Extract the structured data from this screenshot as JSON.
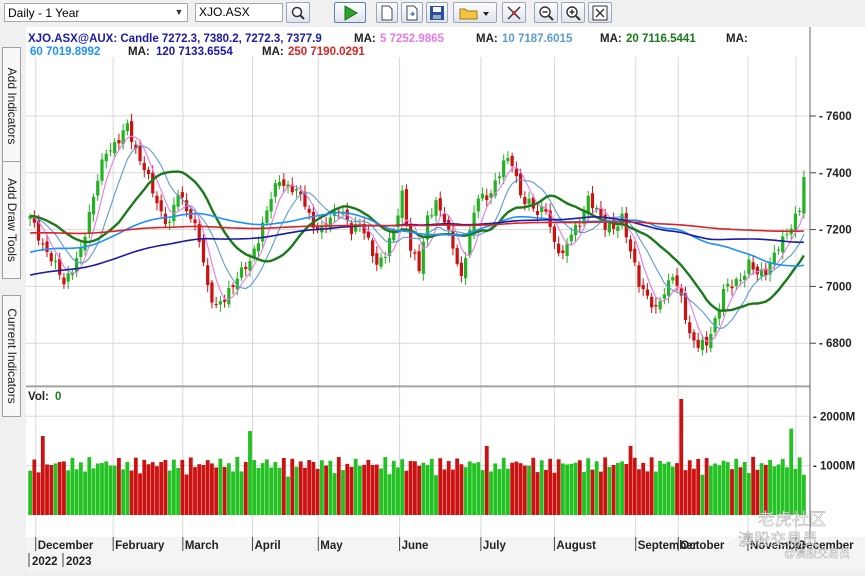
{
  "toolbar": {
    "period": "Daily - 1 Year",
    "symbol": "XJO.ASX",
    "icons": [
      "search-icon",
      "play-icon",
      "new-icon",
      "open-icon",
      "save-icon",
      "folder-icon",
      "crosshair-icon",
      "zoom-out-icon",
      "zoom-in-icon",
      "fit-icon"
    ]
  },
  "sidebar": {
    "tabs": [
      "Add Indicators",
      "Add Draw Tools",
      "Current Indicators"
    ]
  },
  "legend": {
    "symbol": "XJO.ASX@AUX: Candle 7272.3, 7380.2, 7272.3, 7377.9",
    "ma": [
      {
        "label": "MA:",
        "value": "5 7252.9865",
        "color": "#e879e8"
      },
      {
        "label": "MA:",
        "value": "10 7187.6015",
        "color": "#5b9bd5"
      },
      {
        "label": "MA:",
        "value": "20 7116.5441",
        "color": "#1a7a1a"
      },
      {
        "label": "MA:",
        "value": "60 7019.8992",
        "color": "#1e90ff"
      },
      {
        "label": "MA:",
        "value": "120 7133.6554",
        "color": "#1a1aaa"
      },
      {
        "label": "MA:",
        "value": "250 7190.0291",
        "color": "#dd2222"
      }
    ],
    "ma_tail_label": "MA:"
  },
  "volume": {
    "label": "Vol:",
    "value": "0"
  },
  "watermark": {
    "line1": "老虎社区",
    "line2": "澳股交易员",
    "line3": "@澳股交易员"
  },
  "chart_data": {
    "type": "candlestick",
    "price_ylim": [
      6660,
      7790
    ],
    "price_ticks": [
      6800,
      7000,
      7200,
      7400,
      7600
    ],
    "price_tick_labels": [
      "6800",
      "7000",
      "7200",
      "7400",
      "7600"
    ],
    "volume_ylim": [
      0,
      2350
    ],
    "volume_ticks": [
      1000,
      2000
    ],
    "volume_tick_labels": [
      "1000M",
      "2000M"
    ],
    "x_month_labels": [
      "December",
      "February",
      "March",
      "April",
      "May",
      "June",
      "July",
      "August",
      "September",
      "October",
      "November",
      "December"
    ],
    "x_year_labels": [
      "2022",
      "2023"
    ],
    "grid": true,
    "close_anchors": [
      [
        0,
        7240
      ],
      [
        4,
        7120
      ],
      [
        8,
        7020
      ],
      [
        10,
        7060
      ],
      [
        12,
        7120
      ],
      [
        14,
        7260
      ],
      [
        16,
        7380
      ],
      [
        18,
        7470
      ],
      [
        21,
        7520
      ],
      [
        23,
        7560
      ],
      [
        25,
        7480
      ],
      [
        27,
        7420
      ],
      [
        29,
        7330
      ],
      [
        31,
        7260
      ],
      [
        33,
        7220
      ],
      [
        35,
        7330
      ],
      [
        38,
        7250
      ],
      [
        40,
        7160
      ],
      [
        42,
        7000
      ],
      [
        44,
        6930
      ],
      [
        46,
        6950
      ],
      [
        49,
        7040
      ],
      [
        52,
        7080
      ],
      [
        55,
        7220
      ],
      [
        57,
        7310
      ],
      [
        59,
        7380
      ],
      [
        61,
        7350
      ],
      [
        63,
        7330
      ],
      [
        65,
        7300
      ],
      [
        67,
        7210
      ],
      [
        69,
        7190
      ],
      [
        71,
        7250
      ],
      [
        73,
        7270
      ],
      [
        76,
        7200
      ],
      [
        78,
        7230
      ],
      [
        80,
        7150
      ],
      [
        82,
        7080
      ],
      [
        84,
        7120
      ],
      [
        86,
        7190
      ],
      [
        88,
        7330
      ],
      [
        90,
        7130
      ],
      [
        92,
        7060
      ],
      [
        94,
        7250
      ],
      [
        96,
        7290
      ],
      [
        98,
        7230
      ],
      [
        100,
        7150
      ],
      [
        102,
        7020
      ],
      [
        104,
        7190
      ],
      [
        106,
        7330
      ],
      [
        108,
        7300
      ],
      [
        110,
        7360
      ],
      [
        112,
        7450
      ],
      [
        114,
        7430
      ],
      [
        116,
        7320
      ],
      [
        118,
        7300
      ],
      [
        120,
        7250
      ],
      [
        122,
        7280
      ],
      [
        124,
        7150
      ],
      [
        126,
        7100
      ],
      [
        128,
        7200
      ],
      [
        130,
        7220
      ],
      [
        132,
        7300
      ],
      [
        134,
        7280
      ],
      [
        136,
        7210
      ],
      [
        138,
        7200
      ],
      [
        140,
        7250
      ],
      [
        142,
        7120
      ],
      [
        144,
        7010
      ],
      [
        146,
        6970
      ],
      [
        148,
        6910
      ],
      [
        150,
        6980
      ],
      [
        152,
        7050
      ],
      [
        154,
        6950
      ],
      [
        156,
        6830
      ],
      [
        158,
        6800
      ],
      [
        160,
        6790
      ],
      [
        162,
        6880
      ],
      [
        164,
        6990
      ],
      [
        166,
        7000
      ],
      [
        168,
        7030
      ],
      [
        170,
        7080
      ],
      [
        172,
        7040
      ],
      [
        174,
        7060
      ],
      [
        176,
        7110
      ],
      [
        178,
        7160
      ],
      [
        180,
        7220
      ],
      [
        182,
        7270
      ],
      [
        183,
        7378
      ]
    ],
    "ma_series": [
      {
        "period": 5,
        "color": "#e879e8"
      },
      {
        "period": 10,
        "color": "#5b9bd5"
      },
      {
        "period": 20,
        "color": "#1a7a1a"
      },
      {
        "period": 60,
        "color": "#1e90ff"
      },
      {
        "period": 120,
        "color": "#1a1aaa"
      },
      {
        "period": 250,
        "color": "#dd2222"
      }
    ]
  }
}
